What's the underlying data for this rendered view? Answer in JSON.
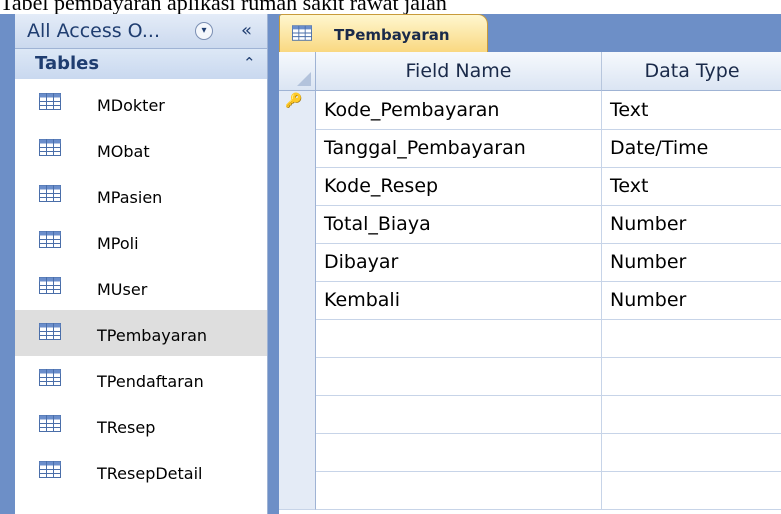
{
  "caption": "Tabel pembayaran aplikasi rumah sakit rawat jalan",
  "nav": {
    "title": "All Access O...",
    "dropdown_glyph": "▾",
    "collapse_glyph": "«",
    "group_title": "Tables",
    "group_chevron": "⌃",
    "items": [
      {
        "label": "MDokter"
      },
      {
        "label": "MObat"
      },
      {
        "label": "MPasien"
      },
      {
        "label": "MPoli"
      },
      {
        "label": "MUser"
      },
      {
        "label": "TPembayaran",
        "selected": true
      },
      {
        "label": "TPendaftaran"
      },
      {
        "label": "TResep"
      },
      {
        "label": "TResepDetail"
      }
    ]
  },
  "tab": {
    "label": "TPembayaran"
  },
  "grid": {
    "columns": [
      "Field Name",
      "Data Type"
    ],
    "rows": [
      {
        "field": "Kode_Pembayaran",
        "type": "Text",
        "primary_key": true
      },
      {
        "field": "Tanggal_Pembayaran",
        "type": "Date/Time"
      },
      {
        "field": "Kode_Resep",
        "type": "Text"
      },
      {
        "field": "Total_Biaya",
        "type": "Number"
      },
      {
        "field": "Dibayar",
        "type": "Number"
      },
      {
        "field": "Kembali",
        "type": "Number"
      }
    ],
    "key_glyph": "🔑"
  }
}
